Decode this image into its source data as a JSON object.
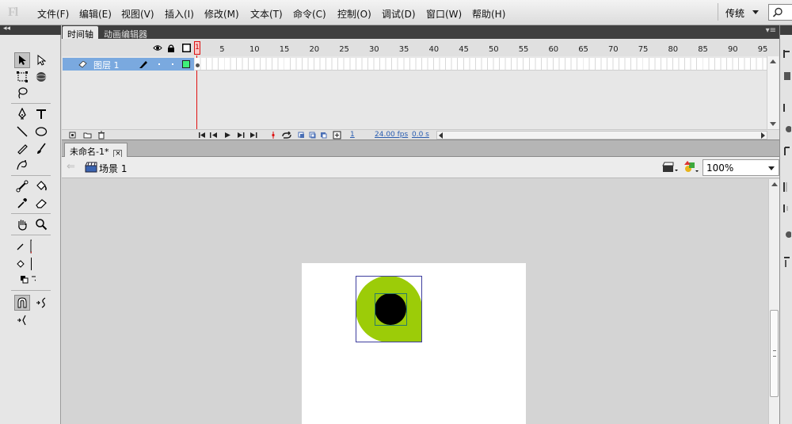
{
  "app": {
    "logo": "Fl",
    "menu": [
      "文件(F)",
      "编辑(E)",
      "视图(V)",
      "插入(I)",
      "修改(M)",
      "文本(T)",
      "命令(C)",
      "控制(O)",
      "调试(D)",
      "窗口(W)",
      "帮助(H)"
    ],
    "workspace": "传统"
  },
  "panel_tabs": {
    "timeline": "时间轴",
    "motion_editor": "动画编辑器"
  },
  "timeline": {
    "playhead_frame": "1",
    "ruler": [
      "5",
      "10",
      "15",
      "20",
      "25",
      "30",
      "35",
      "40",
      "45",
      "50",
      "55",
      "60",
      "65",
      "70",
      "75",
      "80",
      "85",
      "90",
      "95"
    ],
    "layer": {
      "name": "图层 1",
      "outline_color": "#3ef079"
    },
    "footer": {
      "current_frame": "1",
      "fps": "24.00 fps",
      "elapsed": "0.0 s"
    }
  },
  "document": {
    "tab_title": "未命名-1*",
    "scene_name": "场景 1",
    "zoom": "100%"
  },
  "stage_art": {
    "ring_color": "#9ccc08",
    "center_color": "#000000",
    "selection_color": "#3e3e9e"
  }
}
